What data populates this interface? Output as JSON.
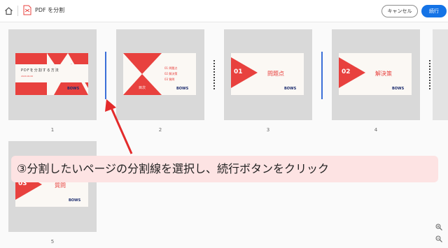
{
  "header": {
    "title": "PDF を分割",
    "cancel_label": "キャンセル",
    "continue_label": "続行"
  },
  "pages": [
    {
      "number": "1",
      "title": "PDFを分割する方法",
      "subtitle": "2020.00.00",
      "logo": "BOWS"
    },
    {
      "number": "2",
      "label": "目次",
      "items": [
        "01 問題点",
        "02 解決策",
        "03 質問"
      ],
      "logo": "BOWS"
    },
    {
      "number": "3",
      "slide_num": "01",
      "heading": "問題点",
      "logo": "BOWS"
    },
    {
      "number": "4",
      "slide_num": "02",
      "heading": "解決策",
      "logo": "BOWS"
    },
    {
      "number": "5",
      "slide_num": "03",
      "heading": "質問",
      "logo": "BOWS"
    }
  ],
  "annotation": "③分割したいページの分割線を選択し、続行ボタンをクリック",
  "colors": {
    "accent": "#e8413e",
    "primary": "#1473e6",
    "split_line": "#3b6fd8"
  },
  "icons": [
    "home-icon",
    "pdf-icon",
    "zoom-in-icon",
    "zoom-out-icon"
  ]
}
